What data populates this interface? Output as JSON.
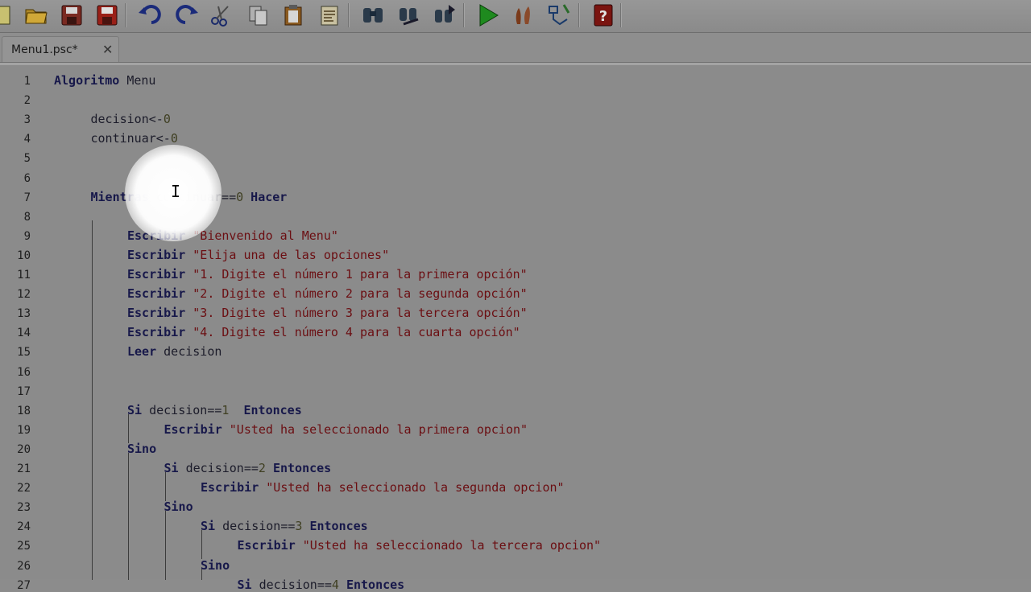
{
  "toolbar": {
    "buttons": [
      {
        "icon": "new-file-icon"
      },
      {
        "icon": "open-folder-icon"
      },
      {
        "icon": "save-icon"
      },
      {
        "icon": "save-as-icon"
      },
      {
        "icon": "undo-icon"
      },
      {
        "icon": "redo-icon"
      },
      {
        "icon": "cut-icon"
      },
      {
        "icon": "copy-icon"
      },
      {
        "icon": "paste-icon"
      },
      {
        "icon": "indent-icon"
      },
      {
        "icon": "find-icon"
      },
      {
        "icon": "replace-icon"
      },
      {
        "icon": "find-next-icon"
      },
      {
        "icon": "run-icon"
      },
      {
        "icon": "step-by-step-icon"
      },
      {
        "icon": "draw-diagram-icon"
      },
      {
        "icon": "help-icon"
      }
    ]
  },
  "tab": {
    "label": "Menu1.psc*",
    "close": "✕"
  },
  "colors": {
    "keyword": "#17184a",
    "string": "#6b0e12",
    "number": "#3f3f22"
  },
  "editor": {
    "lines": [
      {
        "n": "1",
        "indent": 0,
        "tokens": [
          {
            "t": "kw",
            "v": "Algoritmo "
          },
          {
            "t": "id",
            "v": "Menu"
          }
        ]
      },
      {
        "n": "2",
        "indent": 0,
        "tokens": []
      },
      {
        "n": "3",
        "indent": 1,
        "tokens": [
          {
            "t": "id",
            "v": "decision<-"
          },
          {
            "t": "num",
            "v": "0"
          }
        ]
      },
      {
        "n": "4",
        "indent": 1,
        "tokens": [
          {
            "t": "id",
            "v": "continuar<-"
          },
          {
            "t": "num",
            "v": "0"
          }
        ]
      },
      {
        "n": "5",
        "indent": 0,
        "tokens": []
      },
      {
        "n": "6",
        "indent": 0,
        "tokens": []
      },
      {
        "n": "7",
        "indent": 1,
        "tokens": [
          {
            "t": "kw",
            "v": "Mientras "
          },
          {
            "t": "id",
            "v": "continuar=="
          },
          {
            "t": "num",
            "v": "0"
          },
          {
            "t": "kw",
            "v": " Hacer"
          }
        ]
      },
      {
        "n": "8",
        "indent": 0,
        "tokens": []
      },
      {
        "n": "9",
        "indent": 2,
        "tokens": [
          {
            "t": "kw",
            "v": "Escribir "
          },
          {
            "t": "str",
            "v": "\"Bienvenido al Menu\""
          }
        ]
      },
      {
        "n": "10",
        "indent": 2,
        "tokens": [
          {
            "t": "kw",
            "v": "Escribir "
          },
          {
            "t": "str",
            "v": "\"Elija una de las opciones\""
          }
        ]
      },
      {
        "n": "11",
        "indent": 2,
        "tokens": [
          {
            "t": "kw",
            "v": "Escribir "
          },
          {
            "t": "str",
            "v": "\"1. Digite el número 1 para la primera opción\""
          }
        ]
      },
      {
        "n": "12",
        "indent": 2,
        "tokens": [
          {
            "t": "kw",
            "v": "Escribir "
          },
          {
            "t": "str",
            "v": "\"2. Digite el número 2 para la segunda opción\""
          }
        ]
      },
      {
        "n": "13",
        "indent": 2,
        "tokens": [
          {
            "t": "kw",
            "v": "Escribir "
          },
          {
            "t": "str",
            "v": "\"3. Digite el número 3 para la tercera opción\""
          }
        ]
      },
      {
        "n": "14",
        "indent": 2,
        "tokens": [
          {
            "t": "kw",
            "v": "Escribir "
          },
          {
            "t": "str",
            "v": "\"4. Digite el número 4 para la cuarta opción\""
          }
        ]
      },
      {
        "n": "15",
        "indent": 2,
        "tokens": [
          {
            "t": "kw",
            "v": "Leer "
          },
          {
            "t": "id",
            "v": "decision"
          }
        ]
      },
      {
        "n": "16",
        "indent": 0,
        "tokens": []
      },
      {
        "n": "17",
        "indent": 0,
        "tokens": []
      },
      {
        "n": "18",
        "indent": 2,
        "tokens": [
          {
            "t": "kw",
            "v": "Si "
          },
          {
            "t": "id",
            "v": "decision=="
          },
          {
            "t": "num",
            "v": "1"
          },
          {
            "t": "kw",
            "v": "  Entonces"
          }
        ]
      },
      {
        "n": "19",
        "indent": 3,
        "tokens": [
          {
            "t": "kw",
            "v": "Escribir "
          },
          {
            "t": "str",
            "v": "\"Usted ha seleccionado la primera opcion\""
          }
        ]
      },
      {
        "n": "20",
        "indent": 2,
        "tokens": [
          {
            "t": "kw",
            "v": "Sino"
          }
        ]
      },
      {
        "n": "21",
        "indent": 3,
        "tokens": [
          {
            "t": "kw",
            "v": "Si "
          },
          {
            "t": "id",
            "v": "decision=="
          },
          {
            "t": "num",
            "v": "2"
          },
          {
            "t": "kw",
            "v": " Entonces"
          }
        ]
      },
      {
        "n": "22",
        "indent": 4,
        "tokens": [
          {
            "t": "kw",
            "v": "Escribir "
          },
          {
            "t": "str",
            "v": "\"Usted ha seleccionado la segunda opcion\""
          }
        ]
      },
      {
        "n": "23",
        "indent": 3,
        "tokens": [
          {
            "t": "kw",
            "v": "Sino"
          }
        ]
      },
      {
        "n": "24",
        "indent": 4,
        "tokens": [
          {
            "t": "kw",
            "v": "Si "
          },
          {
            "t": "id",
            "v": "decision=="
          },
          {
            "t": "num",
            "v": "3"
          },
          {
            "t": "kw",
            "v": " Entonces"
          }
        ]
      },
      {
        "n": "25",
        "indent": 5,
        "tokens": [
          {
            "t": "kw",
            "v": "Escribir "
          },
          {
            "t": "str",
            "v": "\"Usted ha seleccionado la tercera opcion\""
          }
        ]
      },
      {
        "n": "26",
        "indent": 4,
        "tokens": [
          {
            "t": "kw",
            "v": "Sino"
          }
        ]
      },
      {
        "n": "27",
        "indent": 5,
        "tokens": [
          {
            "t": "kw",
            "v": "Si "
          },
          {
            "t": "id",
            "v": "decision=="
          },
          {
            "t": "num",
            "v": "4"
          },
          {
            "t": "kw",
            "v": " Entonces"
          }
        ]
      }
    ]
  }
}
